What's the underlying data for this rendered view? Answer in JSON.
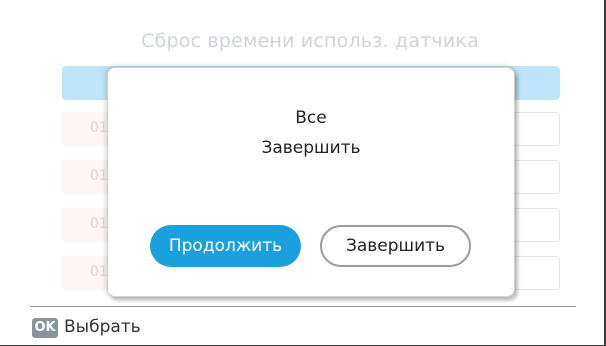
{
  "screen": {
    "title": "Сброс времени использ. датчика",
    "rows": [
      {
        "prefix": "01"
      },
      {
        "prefix": "01"
      },
      {
        "prefix": "01"
      },
      {
        "prefix": "01"
      }
    ]
  },
  "dialog": {
    "line1": "Все",
    "line2": "Завершить",
    "continue_label": "Продолжить",
    "finish_label": "Завершить"
  },
  "footer": {
    "ok_key": "OK",
    "ok_label": "Выбрать"
  },
  "colors": {
    "accent": "#1aa0dc",
    "header_bar": "#bfe3f8",
    "ok_badge": "#8a949c"
  }
}
